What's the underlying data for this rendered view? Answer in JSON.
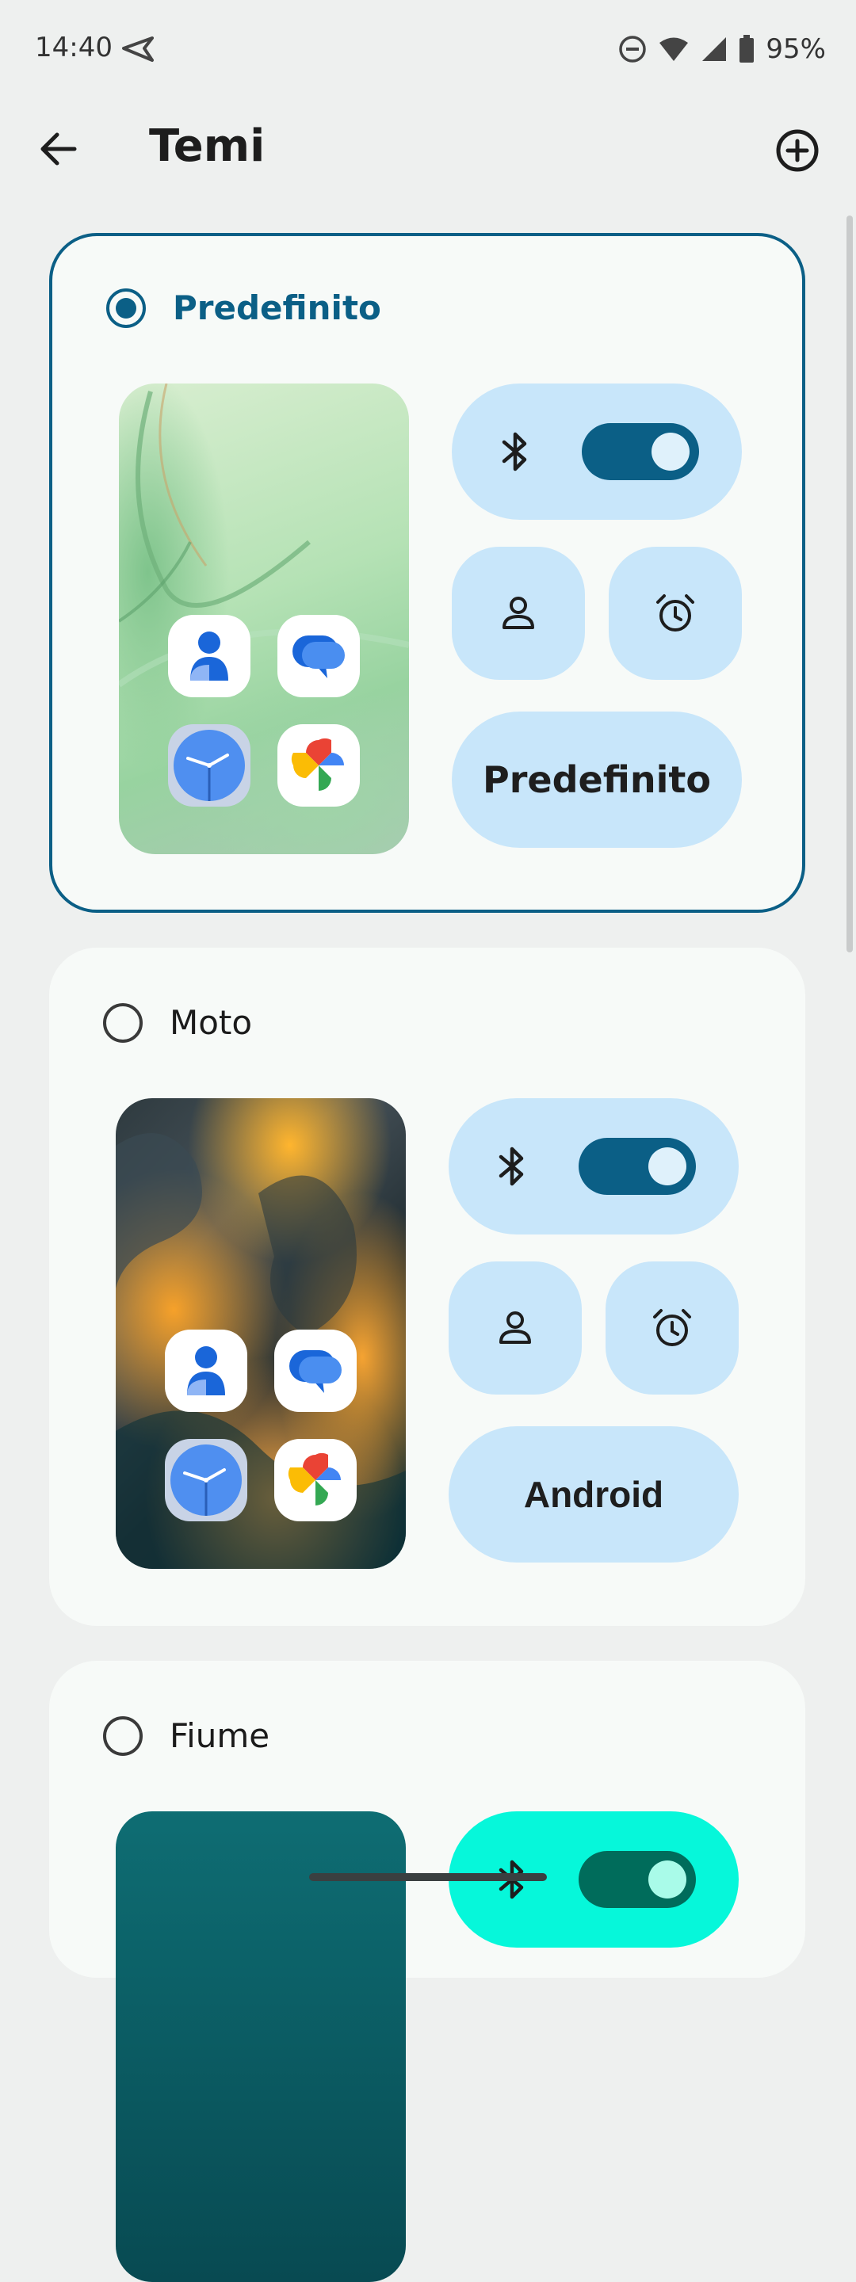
{
  "status_bar": {
    "time": "14:40",
    "battery": "95%",
    "icons": [
      "send-icon",
      "do-not-disturb-icon",
      "wifi-icon",
      "signal-icon",
      "battery-icon"
    ]
  },
  "header": {
    "title": "Temi",
    "back_icon": "arrow-left-icon",
    "add_icon": "add-circle-icon"
  },
  "themes": [
    {
      "name": "Predefinito",
      "selected": true,
      "label": "Predefinito",
      "wallpaper": "green",
      "accent": "#0b5f86"
    },
    {
      "name": "Moto",
      "selected": false,
      "label": "Android",
      "wallpaper": "orange",
      "accent": "#0b5f86"
    },
    {
      "name": "Fiume",
      "selected": false,
      "label": "",
      "wallpaper": "teal",
      "accent": "#06f7da"
    }
  ],
  "colors": {
    "background": "#eef0ef",
    "card": "#f7faf8",
    "tile": "#c8e6fa",
    "accent": "#0b5f86"
  }
}
